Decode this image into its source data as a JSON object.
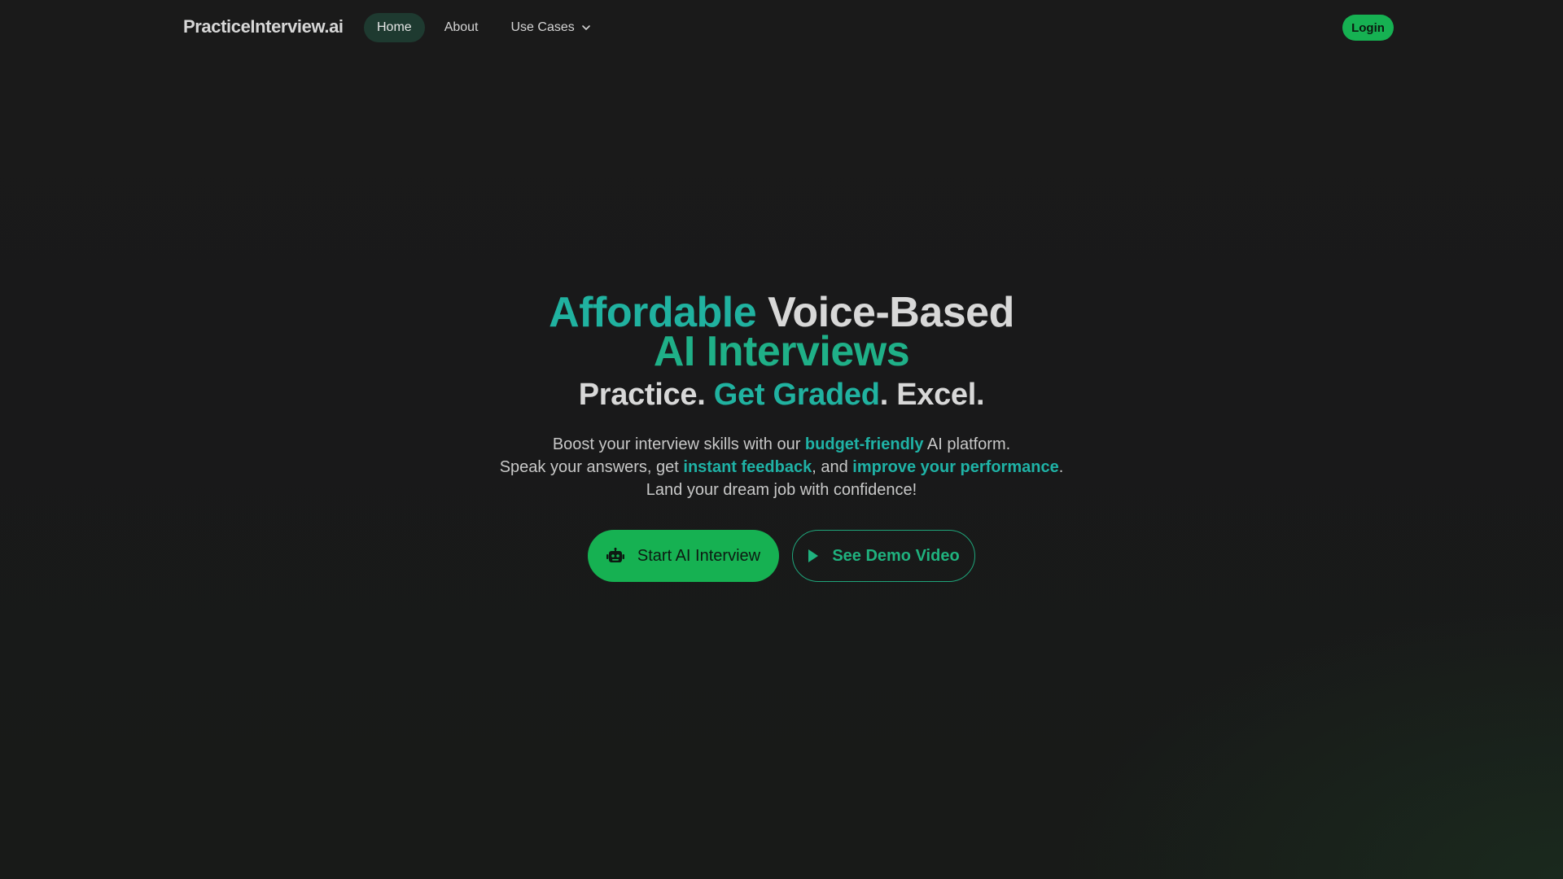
{
  "brand": "PracticeInterview.ai",
  "nav": {
    "items": [
      {
        "label": "Home"
      },
      {
        "label": "About"
      },
      {
        "label": "Use Cases"
      }
    ],
    "login": "Login"
  },
  "hero": {
    "title_word1": "Affordable",
    "title_word2": " Voice-Based",
    "title_line2": "AI Interviews",
    "tagline_part1": "Practice. ",
    "tagline_part2": "Get Graded",
    "tagline_part3": ". Excel.",
    "desc": {
      "l1_a": "Boost your interview skills with our ",
      "l1_b": "budget-friendly",
      "l1_c": " AI platform.",
      "l2_a": "Speak your answers, get ",
      "l2_b": "instant feedback",
      "l2_c": ", and ",
      "l2_d": "improve your performance",
      "l2_e": ".",
      "l3": "Land your dream job with confidence!"
    },
    "cta_primary": "Start AI Interview",
    "cta_secondary": "See Demo Video"
  },
  "colors": {
    "accent_green": "#16b152",
    "accent_teal": "#20b2a0",
    "background": "#1a1a1a"
  }
}
